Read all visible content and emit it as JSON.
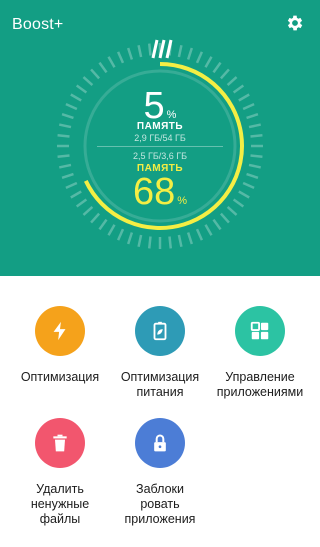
{
  "header": {
    "title": "Boost+",
    "settings_icon": "gear-icon"
  },
  "storage": {
    "percent": "5",
    "percent_sign": "%",
    "label": "ПАМЯТЬ",
    "detail": "2,9 ГБ/54 ГБ"
  },
  "memory": {
    "detail": "2,5 ГБ/3,6 ГБ",
    "label": "ПАМЯТЬ",
    "percent": "68",
    "percent_sign": "%",
    "fraction": 0.68
  },
  "colors": {
    "hero_background": "#139E84",
    "gauge_accent": "#F4EE44"
  },
  "actions": [
    {
      "label_lines": [
        "Оптимизация"
      ],
      "icon": "lightning-icon",
      "color": "#F5A21B"
    },
    {
      "label_lines": [
        "Оптимизация",
        "питания"
      ],
      "icon": "battery-leaf-icon",
      "color": "#2E9BB6"
    },
    {
      "label_lines": [
        "Управление",
        "приложениями"
      ],
      "icon": "app-grid-icon",
      "color": "#2CC3A3"
    },
    {
      "label_lines": [
        "Удалить",
        "ненужные",
        "файлы"
      ],
      "icon": "trash-icon",
      "color": "#F2566E"
    },
    {
      "label_lines": [
        "Заблоки",
        "ровать",
        "приложения"
      ],
      "icon": "lock-icon",
      "color": "#4C7DD6"
    }
  ]
}
